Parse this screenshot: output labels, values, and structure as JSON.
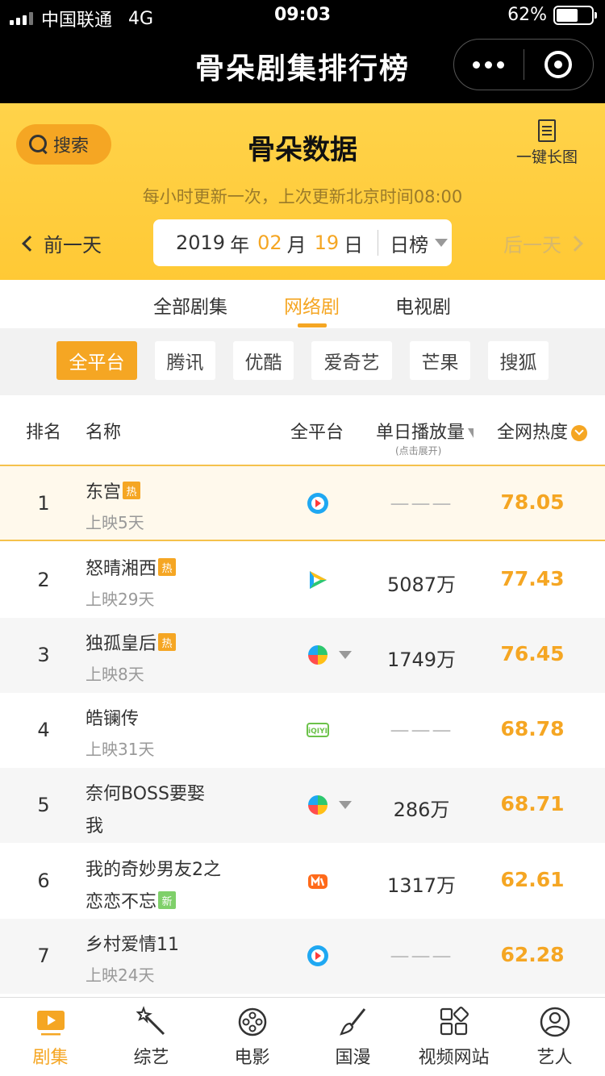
{
  "status_bar": {
    "carrier": "中国联通",
    "network": "4G",
    "time": "09:03",
    "battery_text": "62%",
    "battery_level": 0.62
  },
  "title_bar": {
    "title": "骨朵剧集排行榜"
  },
  "header": {
    "search_label": "搜索",
    "brand": "骨朵数据",
    "long_image_label": "一键长图",
    "update_note": "每小时更新一次，上次更新北京时间08:00",
    "prev_day": "前一天",
    "next_day": "后一天",
    "date": {
      "year": "2019",
      "year_unit": "年",
      "month": "02",
      "month_unit": "月",
      "day": "19",
      "day_unit": "日",
      "board": "日榜"
    }
  },
  "category_tabs": [
    {
      "label": "全部剧集",
      "active": false
    },
    {
      "label": "网络剧",
      "active": true
    },
    {
      "label": "电视剧",
      "active": false
    }
  ],
  "platforms": [
    {
      "label": "全平台",
      "active": true
    },
    {
      "label": "腾讯",
      "active": false
    },
    {
      "label": "优酷",
      "active": false
    },
    {
      "label": "爱奇艺",
      "active": false
    },
    {
      "label": "芒果",
      "active": false
    },
    {
      "label": "搜狐",
      "active": false
    }
  ],
  "table_header": {
    "rank": "排名",
    "name": "名称",
    "platform": "全平台",
    "daily_plays": "单日播放量",
    "daily_plays_hint": "(点击展开)",
    "heat": "全网热度"
  },
  "rows": [
    {
      "rank": "1",
      "title": "东宫",
      "tag": "热",
      "sub": "上映5天",
      "platform_icon": "youku-icon",
      "plays": "———",
      "heat": "78.05"
    },
    {
      "rank": "2",
      "title": "怒晴湘西",
      "tag": "热",
      "sub": "上映29天",
      "platform_icon": "tencent-video-icon",
      "plays": "5087万",
      "heat": "77.43"
    },
    {
      "rank": "3",
      "title": "独孤皇后",
      "tag": "热",
      "sub": "上映8天",
      "platform_icon": "multi-platform-icon",
      "plays": "1749万",
      "heat": "76.45"
    },
    {
      "rank": "4",
      "title": "皓镧传",
      "tag": "",
      "sub": "上映31天",
      "platform_icon": "iqiyi-icon",
      "plays": "———",
      "heat": "68.78"
    },
    {
      "rank": "5",
      "title": "奈何BOSS要娶",
      "tag": "",
      "sub": "我",
      "platform_icon": "multi-platform-icon",
      "plays": "286万",
      "heat": "68.71"
    },
    {
      "rank": "6",
      "title": "我的奇妙男友2之",
      "tag": "",
      "sub": "恋恋不忘",
      "sub_tag": "新",
      "platform_icon": "mango-tv-icon",
      "plays": "1317万",
      "heat": "62.61"
    },
    {
      "rank": "7",
      "title": "乡村爱情11",
      "tag": "",
      "sub": "上映24天",
      "platform_icon": "youku-icon",
      "plays": "———",
      "heat": "62.28"
    }
  ],
  "bottom_nav": [
    {
      "label": "剧集",
      "icon": "tv-play-icon",
      "active": true
    },
    {
      "label": "综艺",
      "icon": "magic-wand-icon",
      "active": false
    },
    {
      "label": "电影",
      "icon": "film-reel-icon",
      "active": false
    },
    {
      "label": "国漫",
      "icon": "brush-icon",
      "active": false
    },
    {
      "label": "视频网站",
      "icon": "apps-grid-icon",
      "active": false
    },
    {
      "label": "艺人",
      "icon": "person-icon",
      "active": false
    }
  ],
  "colors": {
    "accent": "#f5a623",
    "header_yellow": "#ffcf40",
    "new_tag": "#7fd06a"
  }
}
